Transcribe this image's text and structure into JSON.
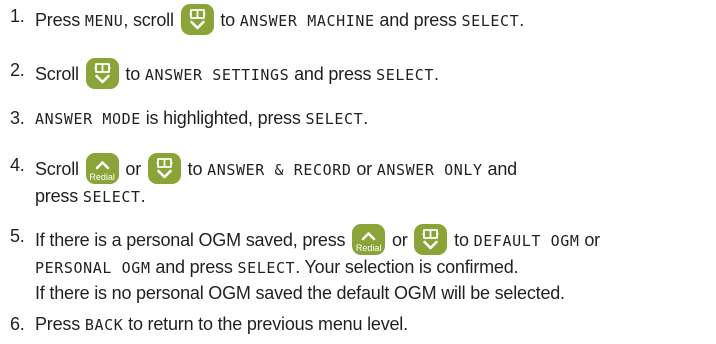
{
  "steps": [
    {
      "number": "1.",
      "parts": [
        {
          "t": "text",
          "v": "Press "
        },
        {
          "t": "lcd",
          "v": "MENU"
        },
        {
          "t": "text",
          "v": ", scroll "
        },
        {
          "t": "icon",
          "v": "phonebook-down"
        },
        {
          "t": "text",
          "v": " to "
        },
        {
          "t": "lcd",
          "v": "ANSWER MACHINE"
        },
        {
          "t": "text",
          "v": " and press "
        },
        {
          "t": "lcd",
          "v": "SELECT"
        },
        {
          "t": "text",
          "v": "."
        }
      ]
    },
    {
      "number": "2.",
      "parts": [
        {
          "t": "text",
          "v": "Scroll "
        },
        {
          "t": "icon",
          "v": "phonebook-down"
        },
        {
          "t": "text",
          "v": " to "
        },
        {
          "t": "lcd",
          "v": "ANSWER SETTINGS"
        },
        {
          "t": "text",
          "v": " and press "
        },
        {
          "t": "lcd",
          "v": "SELECT"
        },
        {
          "t": "text",
          "v": "."
        }
      ]
    },
    {
      "number": "3.",
      "parts": [
        {
          "t": "lcd",
          "v": "ANSWER MODE"
        },
        {
          "t": "text",
          "v": " is highlighted, press "
        },
        {
          "t": "lcd",
          "v": "SELECT"
        },
        {
          "t": "text",
          "v": "."
        }
      ]
    },
    {
      "number": "4.",
      "parts": [
        {
          "t": "text",
          "v": "Scroll "
        },
        {
          "t": "icon",
          "v": "redial-up"
        },
        {
          "t": "text",
          "v": " or "
        },
        {
          "t": "icon",
          "v": "phonebook-down"
        },
        {
          "t": "text",
          "v": " to "
        },
        {
          "t": "lcd",
          "v": "ANSWER & RECORD"
        },
        {
          "t": "text",
          "v": " or "
        },
        {
          "t": "lcd",
          "v": "ANSWER ONLY"
        },
        {
          "t": "text",
          "v": " and"
        },
        {
          "t": "br"
        },
        {
          "t": "text",
          "v": "press "
        },
        {
          "t": "lcd",
          "v": "SELECT"
        },
        {
          "t": "text",
          "v": "."
        }
      ]
    },
    {
      "number": "5.",
      "parts": [
        {
          "t": "text",
          "v": "If there is a personal OGM saved, press "
        },
        {
          "t": "icon",
          "v": "redial-up"
        },
        {
          "t": "text",
          "v": " or "
        },
        {
          "t": "icon",
          "v": "phonebook-down"
        },
        {
          "t": "text",
          "v": " to "
        },
        {
          "t": "lcd",
          "v": "DEFAULT OGM"
        },
        {
          "t": "text",
          "v": " or"
        },
        {
          "t": "br"
        },
        {
          "t": "lcd",
          "v": "PERSONAL OGM"
        },
        {
          "t": "text",
          "v": " and press "
        },
        {
          "t": "lcd",
          "v": "SELECT"
        },
        {
          "t": "text",
          "v": ". Your selection is confirmed."
        },
        {
          "t": "br"
        },
        {
          "t": "text",
          "v": "If there is no personal OGM saved the default OGM will be selected."
        }
      ]
    },
    {
      "number": "6.",
      "parts": [
        {
          "t": "text",
          "v": "Press "
        },
        {
          "t": "lcd",
          "v": "BACK"
        },
        {
          "t": "text",
          "v": " to return to the previous menu level."
        }
      ]
    }
  ],
  "icons": {
    "redial_label": "Redial",
    "key_color": "#8aa438"
  }
}
